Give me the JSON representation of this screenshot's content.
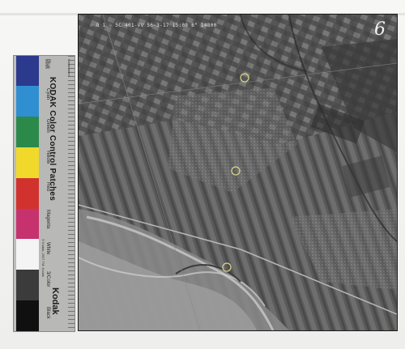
{
  "photo": {
    "header_text": "☉ 8 1 ☉ 5C 401-VV 56-3-17 15:08 6\" 14800",
    "frame_number": "6"
  },
  "kodak_strip": {
    "title": "KODAK Color Control Patches",
    "brand": "Kodak",
    "centimeters_label": "Centimeters",
    "inches_label": "Inches",
    "copyright": "© Kodak, 2007 TM: Kodak",
    "patch_names": [
      "Blue",
      "Cyan",
      "Green",
      "Yellow",
      "Red",
      "Magenta",
      "White",
      "3/Color",
      "Black"
    ],
    "patch_colors": [
      "#2b3a8c",
      "#2f8fd0",
      "#2b8a4a",
      "#f0d92b",
      "#d2322e",
      "#c6326e",
      "#f4f4f4",
      "#3b3b3b",
      "#101010"
    ]
  }
}
